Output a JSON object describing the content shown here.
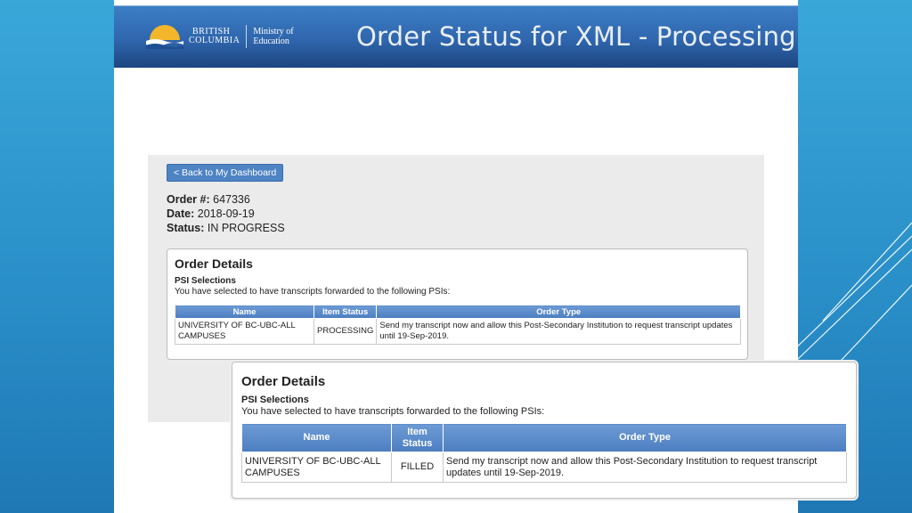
{
  "banner": {
    "logo_line1": "BRITISH",
    "logo_line2": "COLUMBIA",
    "ministry_line1": "Ministry of",
    "ministry_line2": "Education",
    "title": "Order Status for XML - Processing"
  },
  "back_button": {
    "label": "< Back to My Dashboard"
  },
  "order": {
    "number_label": "Order #:",
    "number": "647336",
    "date_label": "Date:",
    "date": "2018-09-19",
    "status_label": "Status:",
    "status": "IN PROGRESS"
  },
  "details": {
    "title": "Order Details",
    "psi_label": "PSI Selections",
    "psi_desc": "You have selected to have transcripts forwarded to the following PSIs:",
    "columns": [
      "Name",
      "Item Status",
      "Order Type"
    ],
    "row": {
      "name": "UNIVERSITY OF BC-UBC-ALL CAMPUSES",
      "status": "PROCESSING",
      "order_type": "Send my transcript now and allow this Post-Secondary Institution to request transcript updates until 19-Sep-2019."
    }
  },
  "details_zoom": {
    "title": "Order Details",
    "psi_label": "PSI Selections",
    "psi_desc": "You have selected to have transcripts forwarded to the following PSIs:",
    "columns": [
      "Name",
      "Item Status",
      "Order Type"
    ],
    "row": {
      "name": "UNIVERSITY OF BC-UBC-ALL CAMPUSES",
      "status": "FILLED",
      "order_type": "Send my transcript now and allow this Post-Secondary Institution to request transcript updates until 19-Sep-2019."
    }
  },
  "colors": {
    "banner": "#2f66ad",
    "table_header": "#4c7dc0",
    "filled_status": "#2c62b0",
    "background": "#2a8fc8"
  }
}
